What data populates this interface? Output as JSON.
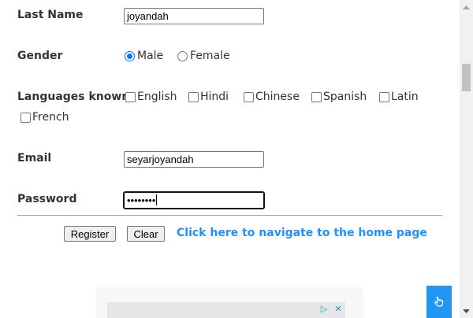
{
  "form": {
    "last_name": {
      "label": "Last Name",
      "value": "joyandah"
    },
    "gender": {
      "label": "Gender",
      "options": [
        {
          "label": "Male",
          "checked": true
        },
        {
          "label": "Female",
          "checked": false
        }
      ]
    },
    "languages": {
      "label": "Languages known",
      "options": [
        {
          "label": "English",
          "checked": false
        },
        {
          "label": "Hindi",
          "checked": false
        },
        {
          "label": "Chinese",
          "checked": false
        },
        {
          "label": "Spanish",
          "checked": false
        },
        {
          "label": "Latin",
          "checked": false
        },
        {
          "label": "French",
          "checked": false
        }
      ]
    },
    "email": {
      "label": "Email",
      "value": "seyarjoyandah"
    },
    "password": {
      "label": "Password",
      "masked_value": "••••••••"
    }
  },
  "actions": {
    "register_label": "Register",
    "clear_label": "Clear",
    "home_link_text": "Click here to navigate to the home page"
  },
  "colors": {
    "link": "#1e90ff",
    "radio_accent": "#0075ff",
    "scroll_button": "#2196f3"
  },
  "icons": {
    "scroll_button": "hand-pointer-icon",
    "ad_choices": "ad-choices-icon",
    "ad_close": "close-icon"
  }
}
